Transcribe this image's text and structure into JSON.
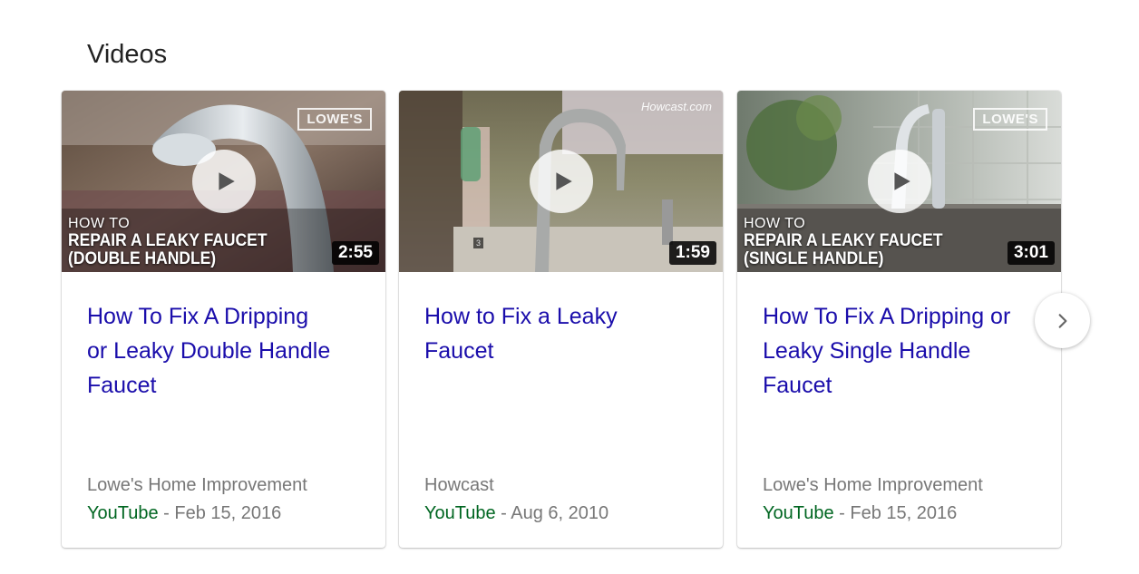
{
  "section": {
    "title": "Videos"
  },
  "cards": [
    {
      "duration": "2:55",
      "overlay_small": "HOW TO",
      "overlay_line1": "REPAIR A LEAKY FAUCET",
      "overlay_line2": "(DOUBLE HANDLE)",
      "brand": "LOWE'S",
      "title_lines": [
        "How To Fix A Dripping",
        "or Leaky Double Handle",
        "Faucet"
      ],
      "channel": "Lowe's Home Improvement",
      "source": "YouTube",
      "date": " - Feb 15, 2016"
    },
    {
      "duration": "1:59",
      "brand": "Howcast.com",
      "mark": "3",
      "title_lines": [
        "How to Fix a Leaky",
        "Faucet"
      ],
      "channel": "Howcast",
      "source": "YouTube",
      "date": " - Aug 6, 2010"
    },
    {
      "duration": "3:01",
      "overlay_small": "HOW TO",
      "overlay_line1": "REPAIR A LEAKY FAUCET",
      "overlay_line2": "(SINGLE HANDLE)",
      "brand": "LOWE'S",
      "title_lines": [
        "How To Fix A Dripping or",
        "Leaky Single Handle",
        "Faucet"
      ],
      "channel": "Lowe's Home Improvement",
      "source": "YouTube",
      "date": " - Feb 15, 2016"
    }
  ],
  "icons": {
    "play": "play-icon",
    "next": "chevron-right-icon"
  },
  "colors": {
    "title_link": "#1a0dab",
    "source": "#006621",
    "meta": "#777777"
  }
}
